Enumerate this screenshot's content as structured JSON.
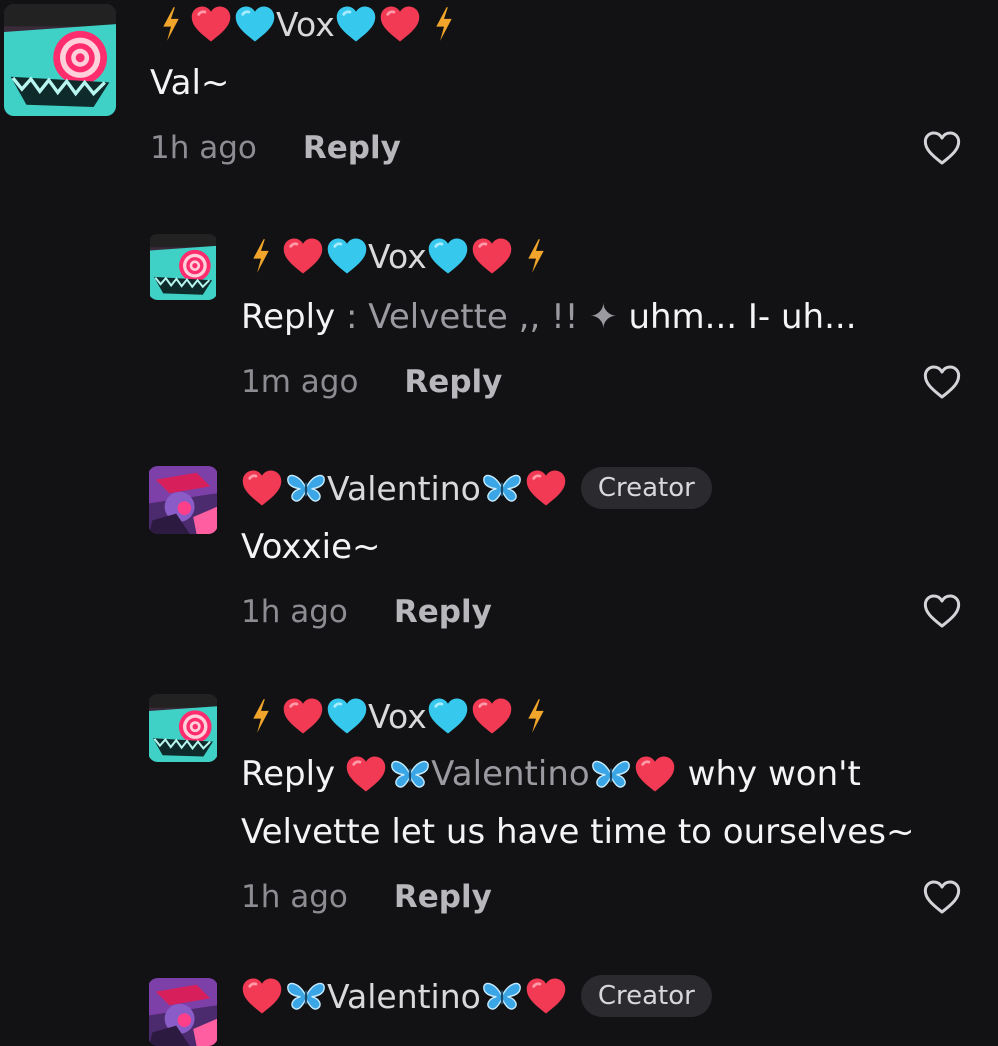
{
  "colors": {
    "background": "#121214",
    "heart_red": "#f23a55",
    "heart_cyan": "#37c8ee",
    "bolt": "#f1a52a",
    "butterfly": "#3aa6e6"
  },
  "comments": [
    {
      "username": "Vox",
      "body": "Val~",
      "time": "1h ago",
      "reply_label": "Reply",
      "avatar": "vox-avatar"
    },
    {
      "username": "Vox",
      "reply_prefix": "Reply",
      "reply_target": ": Velvette ,, !! ✦",
      "body": "uhm... I- uh...",
      "time": "1m ago",
      "reply_label": "Reply",
      "avatar": "vox-avatar"
    },
    {
      "username": "Valentino",
      "badge": "Creator",
      "body": "Voxxie~",
      "time": "1h ago",
      "reply_label": "Reply",
      "avatar": "valentino-avatar"
    },
    {
      "username": "Vox",
      "reply_prefix": "Reply",
      "reply_target": "Valentino",
      "body_line1": "why won't",
      "body_line2": "Velvette let us have time to ourselves~",
      "time": "1h ago",
      "reply_label": "Reply",
      "avatar": "vox-avatar"
    },
    {
      "username": "Valentino",
      "badge": "Creator",
      "avatar": "valentino-avatar"
    }
  ]
}
